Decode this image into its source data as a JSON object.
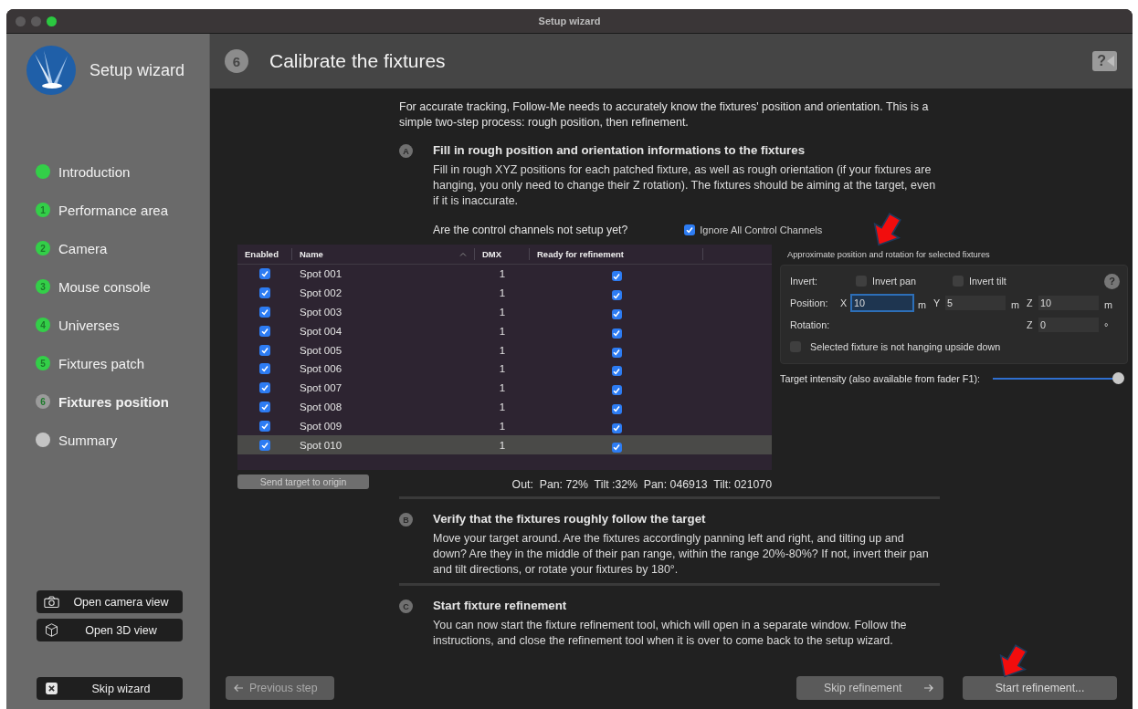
{
  "window": {
    "title": "Setup wizard"
  },
  "sidebar": {
    "title": "Setup wizard",
    "steps": [
      {
        "label": "Introduction",
        "done": true,
        "current": false
      },
      {
        "badge": "1",
        "label": "Performance area",
        "done": true,
        "current": false
      },
      {
        "badge": "2",
        "label": "Camera",
        "done": true,
        "current": false
      },
      {
        "badge": "3",
        "label": "Mouse console",
        "done": true,
        "current": false
      },
      {
        "badge": "4",
        "label": "Universes",
        "done": true,
        "current": false
      },
      {
        "badge": "5",
        "label": "Fixtures patch",
        "done": true,
        "current": false
      },
      {
        "badge": "6",
        "label": "Fixtures position",
        "done": false,
        "current": true
      },
      {
        "label": "Summary",
        "done": false,
        "current": false
      }
    ],
    "view_buttons": [
      {
        "label": "Open camera view",
        "kind": "camera"
      },
      {
        "label": "Open 3D view",
        "kind": "cube"
      }
    ],
    "skip_button": "Skip wizard"
  },
  "header": {
    "step": "6",
    "title": "Calibrate the fixtures",
    "help": "?"
  },
  "intro": "For accurate tracking, Follow-Me needs to accurately know the fixtures' position and orientation. This is a simple two-step process: rough position, then refinement.",
  "sections": [
    {
      "letter": "A",
      "title": "Fill in rough position and orientation informations to the fixtures",
      "text": "Fill in rough XYZ positions for each patched fixture, as well as rough orientation (if your fixtures are hanging, you only need to change their Z rotation). The fixtures should be aiming at the target, even if it is inaccurate."
    },
    {
      "letter": "B",
      "title": "Verify that the fixtures roughly follow the target",
      "text": "Move your target around. Are the fixtures accordingly panning left and right, and tilting up and down? Are they in the middle of their pan range, within the range 20%-80%? If not, invert their pan and tilt directions, or rotate your fixtures by 180°."
    },
    {
      "letter": "C",
      "title": "Start fixture refinement",
      "text": "You can now start the fixture refinement tool, which will open in a separate window. Follow the instructions, and close the refinement tool when it is over to come back to the setup wizard."
    }
  ],
  "control_question": {
    "label": "Are the control channels not setup yet?",
    "checkbox": {
      "label": "Ignore All Control Channels",
      "checked": true
    }
  },
  "table": {
    "columns": [
      {
        "label": "Enabled",
        "sorted": false
      },
      {
        "label": "Name",
        "sorted": true
      },
      {
        "label": "DMX",
        "sorted": false
      },
      {
        "label": "Ready for refinement",
        "sorted": false
      }
    ],
    "rows": [
      {
        "enabled": true,
        "name": "Spot 001",
        "dmx": "1",
        "ready": true,
        "selected": false
      },
      {
        "enabled": true,
        "name": "Spot 002",
        "dmx": "1",
        "ready": true,
        "selected": false
      },
      {
        "enabled": true,
        "name": "Spot 003",
        "dmx": "1",
        "ready": true,
        "selected": false
      },
      {
        "enabled": true,
        "name": "Spot 004",
        "dmx": "1",
        "ready": true,
        "selected": false
      },
      {
        "enabled": true,
        "name": "Spot 005",
        "dmx": "1",
        "ready": true,
        "selected": false
      },
      {
        "enabled": true,
        "name": "Spot 006",
        "dmx": "1",
        "ready": true,
        "selected": false
      },
      {
        "enabled": true,
        "name": "Spot 007",
        "dmx": "1",
        "ready": true,
        "selected": false
      },
      {
        "enabled": true,
        "name": "Spot 008",
        "dmx": "1",
        "ready": true,
        "selected": false
      },
      {
        "enabled": true,
        "name": "Spot 009",
        "dmx": "1",
        "ready": true,
        "selected": false
      },
      {
        "enabled": true,
        "name": "Spot 010",
        "dmx": "1",
        "ready": true,
        "selected": true
      }
    ]
  },
  "send_button": "Send target to origin",
  "output": "Out:  Pan: 72%  Tilt :32%  Pan: 046913  Tilt: 021070",
  "fixture_panel": {
    "title": "Approximate position and rotation for selected fixtures",
    "arrow_marked": true,
    "invert_label": "Invert:",
    "help": "?",
    "invert_options": [
      {
        "label": "Invert pan",
        "checked": false
      },
      {
        "label": "Invert tilt",
        "checked": false
      }
    ],
    "position_label": "Position:",
    "position": [
      {
        "axis": "X",
        "value": "10",
        "unit": "m",
        "focused": true
      },
      {
        "axis": "Y",
        "value": "5",
        "unit": "m",
        "focused": false
      },
      {
        "axis": "Z",
        "value": "10",
        "unit": "m",
        "focused": false
      }
    ],
    "rotation_label": "Rotation:",
    "rotation": {
      "axis": "Z",
      "value": "0",
      "unit": "°"
    },
    "hanging": {
      "label": "Selected fixture is not hanging upside down",
      "checked": false
    }
  },
  "intensity": {
    "label": "Target intensity (also available from fader F1):",
    "level": 0.98
  },
  "footer": {
    "previous": "Previous step",
    "skip": "Skip refinement",
    "start": {
      "label": "Start refinement...",
      "arrow_marked": true
    }
  }
}
